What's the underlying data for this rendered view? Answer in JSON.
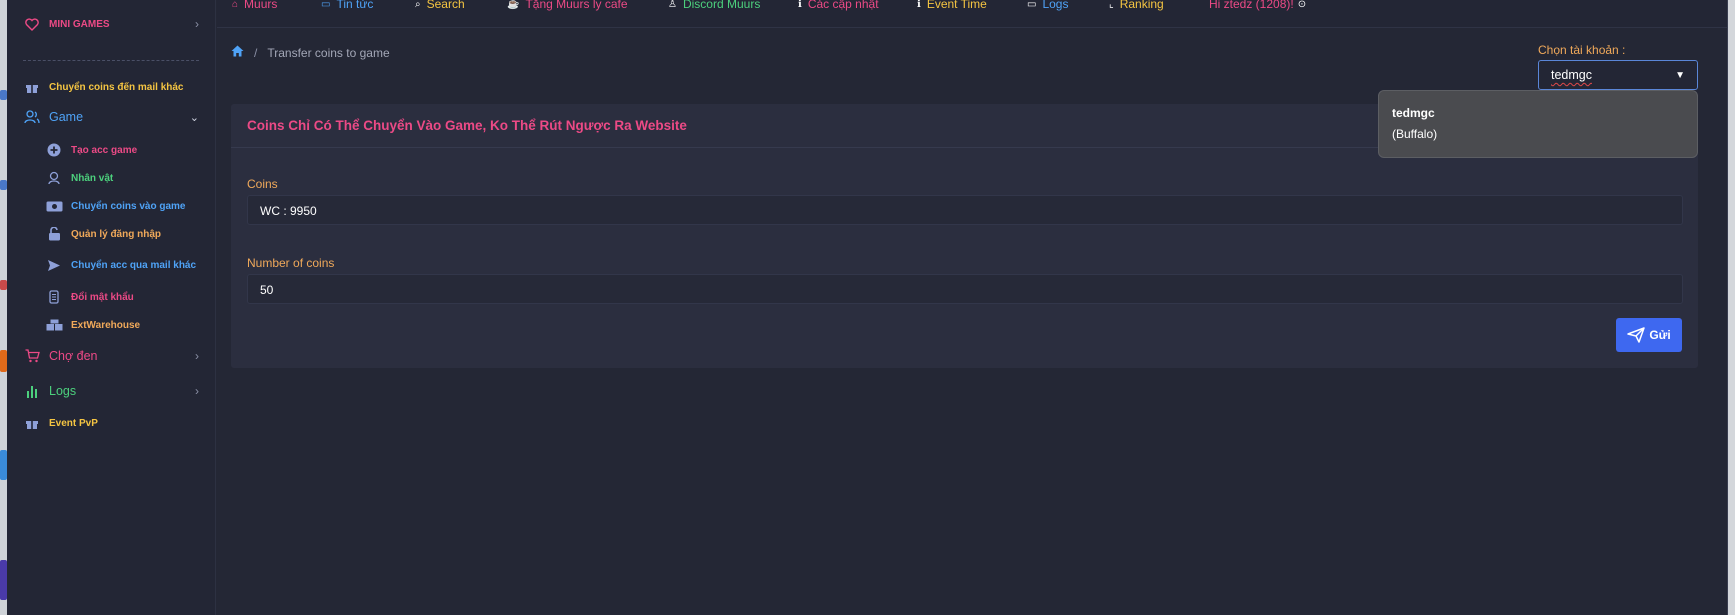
{
  "colors": {
    "bg": "#242735",
    "sidebar": "#232635",
    "card": "#2b2e3f",
    "pink": "#ec4a86",
    "orange": "#f0a95a",
    "blue": "#4fa3f7",
    "green": "#4cd07d",
    "yellow": "#f5c542",
    "primary_button": "#3e68f0"
  },
  "sidebar": {
    "mini_games": "MINI GAMES",
    "mail_transfer": "Chuyển coins đến mail khác",
    "game": "Game",
    "game_items": [
      {
        "label": "Tạo acc game",
        "icon": "plus-circle-icon"
      },
      {
        "label": "Nhân vật",
        "icon": "character-icon"
      },
      {
        "label": "Chuyển coins vào game",
        "icon": "money-icon"
      },
      {
        "label": "Quản lý đăng nhập",
        "icon": "unlock-icon"
      },
      {
        "label": "Chuyển acc qua mail khác",
        "icon": "send-icon"
      },
      {
        "label": "Đổi mật khẩu",
        "icon": "scroll-icon"
      },
      {
        "label": "ExtWarehouse",
        "icon": "boxes-icon"
      }
    ],
    "cho_den": "Chợ đen",
    "logs": "Logs",
    "event_pvp": "Event PvP"
  },
  "topnav": {
    "items": [
      {
        "label": "Muurs",
        "icon": "shop-icon"
      },
      {
        "label": "Tin tức",
        "icon": "news-icon"
      },
      {
        "label": "Search",
        "icon": "search-icon"
      },
      {
        "label": "Tặng Muurs ly cafe",
        "icon": "coffee-icon"
      },
      {
        "label": "Discord Muurs",
        "icon": "discord-icon"
      },
      {
        "label": "Các cập nhật",
        "icon": "info-icon"
      },
      {
        "label": "Event Time",
        "icon": "info-icon"
      },
      {
        "label": "Logs",
        "icon": "logs-icon"
      },
      {
        "label": "Ranking",
        "icon": "chart-icon"
      }
    ],
    "user_greeting": "Hi ztedz (1208)!"
  },
  "breadcrumb": {
    "current": "Transfer coins to game"
  },
  "account": {
    "label": "Chọn tài khoản :",
    "selected": "tedmgc",
    "tooltip_name": "tedmgc",
    "tooltip_detail": "(Buffalo)"
  },
  "card": {
    "title": "Coins Chỉ Có Thể Chuyển Vào Game, Ko Thể Rút Ngược Ra Website",
    "coins_label": "Coins",
    "coins_value": "WC : 9950",
    "number_label": "Number of coins",
    "number_value": "50",
    "send_label": "Gửi"
  }
}
